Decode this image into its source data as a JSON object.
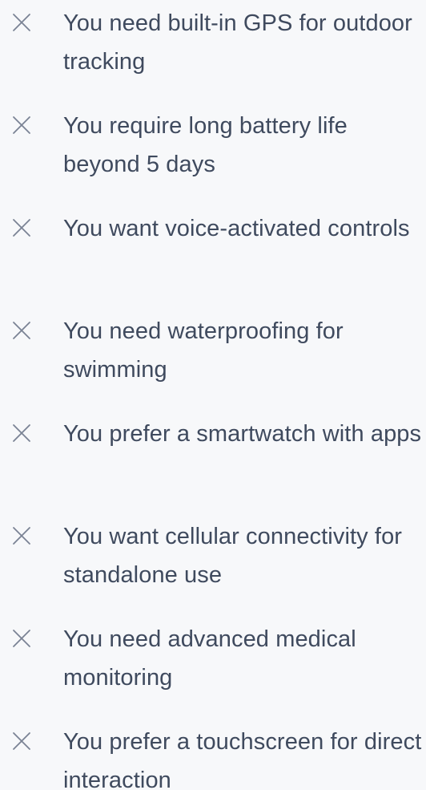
{
  "reasons": {
    "icon": "close-x-icon",
    "icon_color": "#7a8394",
    "text_color": "#3f4a5e",
    "background": "#f7f8fa",
    "items": [
      {
        "text": "You need built-in GPS for outdoor tracking"
      },
      {
        "text": "You require long battery life beyond 5 days"
      },
      {
        "text": "You want voice-activated controls"
      },
      {
        "text": "You need waterproofing for swimming"
      },
      {
        "text": "You prefer a smartwatch with apps"
      },
      {
        "text": "You want cellular connectivity for standalone use"
      },
      {
        "text": "You need advanced medical monitoring"
      },
      {
        "text": "You prefer a touchscreen for direct interaction"
      }
    ]
  }
}
